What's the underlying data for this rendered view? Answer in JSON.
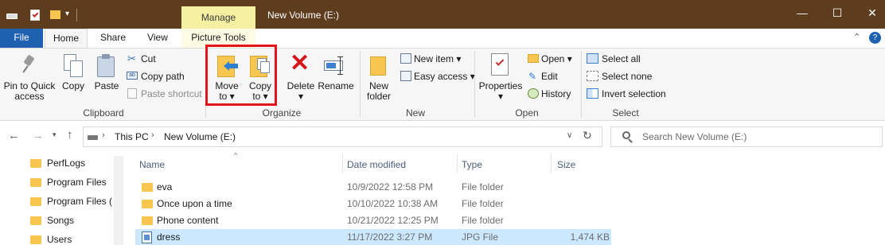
{
  "titlebar": {
    "manage_label": "Manage",
    "window_title": "New Volume (E:)",
    "minimize": "—",
    "maximize": "☐",
    "close": "✕"
  },
  "tabs": {
    "file": "File",
    "home": "Home",
    "share": "Share",
    "view": "View",
    "picture_tools": "Picture Tools"
  },
  "ribbon": {
    "clipboard": {
      "pin": "Pin to Quick access",
      "pin_line1": "Pin to Quick",
      "pin_line2": "access",
      "copy": "Copy",
      "paste": "Paste",
      "cut": "Cut",
      "copy_path": "Copy path",
      "paste_shortcut": "Paste shortcut",
      "group": "Clipboard"
    },
    "organize": {
      "move_line1": "Move",
      "move_line2": "to ▾",
      "copy_line1": "Copy",
      "copy_line2": "to ▾",
      "delete": "Delete",
      "delete_arrow": "▾",
      "rename": "Rename",
      "group": "Organize"
    },
    "new": {
      "new_folder_line1": "New",
      "new_folder_line2": "folder",
      "new_item": "New item ▾",
      "easy_access": "Easy access ▾",
      "group": "New"
    },
    "open": {
      "properties": "Properties",
      "properties_arrow": "▾",
      "open": "Open ▾",
      "edit": "Edit",
      "history": "History",
      "group": "Open"
    },
    "select": {
      "select_all": "Select all",
      "select_none": "Select none",
      "invert": "Invert selection",
      "group": "Select"
    }
  },
  "address": {
    "crumbs": [
      "This PC",
      "New Volume (E:)"
    ],
    "search_placeholder": "Search New Volume (E:)"
  },
  "nav": {
    "items": [
      "PerfLogs",
      "Program Files",
      "Program Files (",
      "Songs",
      "Users"
    ]
  },
  "list": {
    "headers": {
      "name": "Name",
      "date": "Date modified",
      "type": "Type",
      "size": "Size"
    },
    "rows": [
      {
        "name": "eva",
        "date": "10/9/2022 12:58 PM",
        "type": "File folder",
        "size": ""
      },
      {
        "name": "Once upon a time",
        "date": "10/10/2022 10:38 AM",
        "type": "File folder",
        "size": ""
      },
      {
        "name": "Phone content",
        "date": "10/21/2022 12:25 PM",
        "type": "File folder",
        "size": ""
      },
      {
        "name": "dress",
        "date": "11/17/2022 3:27 PM",
        "type": "JPG File",
        "size": "1,474 KB"
      }
    ]
  },
  "colors": {
    "titlebar": "#5e3d1f",
    "file_tab": "#1f61b1",
    "manage_tab": "#f6f0a2",
    "highlight_box": "#e3141b",
    "selected_row": "#cce8ff"
  }
}
